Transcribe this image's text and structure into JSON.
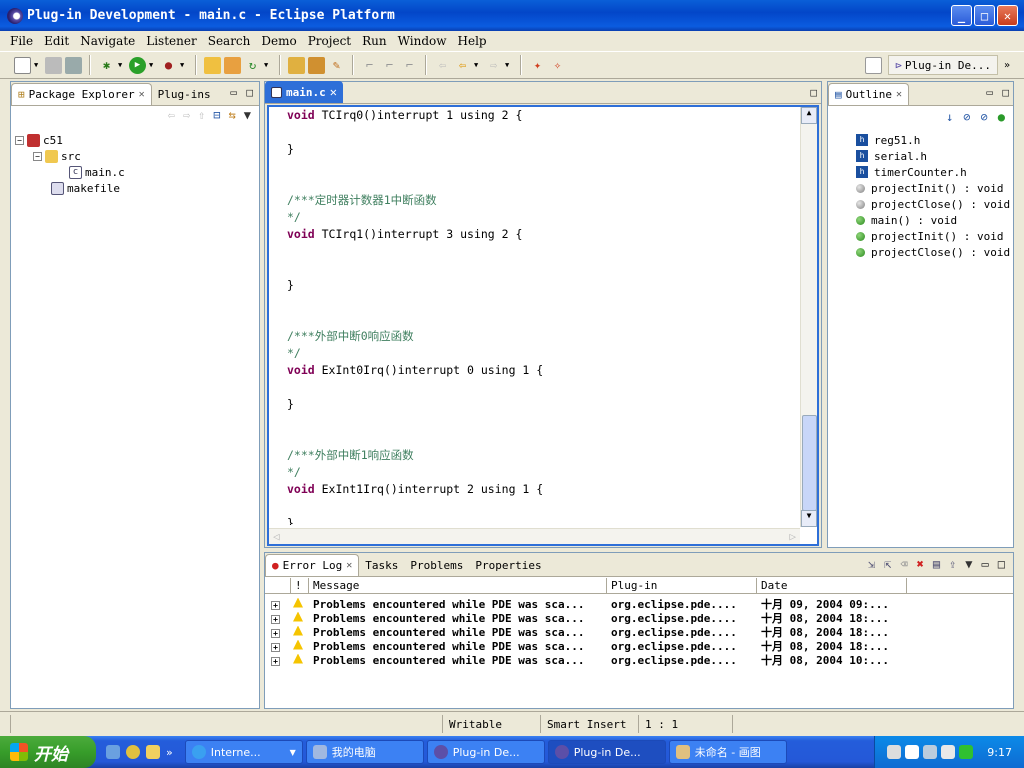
{
  "window": {
    "title": "Plug-in Development - main.c - Eclipse Platform"
  },
  "menu": [
    "File",
    "Edit",
    "Navigate",
    "Listener",
    "Search",
    "Demo",
    "Project",
    "Run",
    "Window",
    "Help"
  ],
  "perspective": {
    "label": "Plug-in De..."
  },
  "package_explorer": {
    "tabs": [
      "Package Explorer",
      "Plug-ins"
    ],
    "tree": [
      {
        "label": "c51",
        "depth": 0,
        "icon": "c-project-icon"
      },
      {
        "label": "src",
        "depth": 1,
        "icon": "folder-icon"
      },
      {
        "label": "main.c",
        "depth": 2,
        "icon": "c-file-icon"
      },
      {
        "label": "makefile",
        "depth": 1,
        "icon": "makefile-icon"
      }
    ]
  },
  "editor": {
    "tab": "main.c",
    "lines": [
      {
        "kw": "void",
        "rest": " TCIrq0()interrupt 1 using 2 {"
      },
      {
        "text": ""
      },
      {
        "text": "}"
      },
      {
        "text": ""
      },
      {
        "text": ""
      },
      {
        "comment": "/***定时器计数器1中断函数"
      },
      {
        "comment": "*/"
      },
      {
        "kw": "void",
        "rest": " TCIrq1()interrupt 3 using 2 {"
      },
      {
        "text": ""
      },
      {
        "text": ""
      },
      {
        "text": "}"
      },
      {
        "text": ""
      },
      {
        "text": ""
      },
      {
        "comment": "/***外部中断0响应函数"
      },
      {
        "comment": "*/"
      },
      {
        "kw": "void",
        "rest": " ExInt0Irq()interrupt 0 using 1 {"
      },
      {
        "text": ""
      },
      {
        "text": "}"
      },
      {
        "text": ""
      },
      {
        "text": ""
      },
      {
        "comment": "/***外部中断1响应函数"
      },
      {
        "comment": "*/"
      },
      {
        "kw": "void",
        "rest": " ExInt1Irq()interrupt 2 using 1 {"
      },
      {
        "text": ""
      },
      {
        "text": "}"
      }
    ]
  },
  "outline": {
    "tab": "Outline",
    "items": [
      {
        "label": "reg51.h",
        "icon": "include"
      },
      {
        "label": "serial.h",
        "icon": "include"
      },
      {
        "label": "timerCounter.h",
        "icon": "include"
      },
      {
        "label": "projectInit() : void",
        "icon": "grey"
      },
      {
        "label": "projectClose() : void",
        "icon": "grey"
      },
      {
        "label": "main() : void",
        "icon": "green"
      },
      {
        "label": "projectInit() : void",
        "icon": "green"
      },
      {
        "label": "projectClose() : void",
        "icon": "green"
      }
    ]
  },
  "bottom_panel": {
    "tabs": [
      "Error Log",
      "Tasks",
      "Problems",
      "Properties"
    ],
    "columns": [
      "!",
      "Message",
      "Plug-in",
      "Date"
    ],
    "rows": [
      {
        "message": "Problems encountered while PDE was sca...",
        "plugin": "org.eclipse.pde....",
        "date": "十月 09, 2004 09:..."
      },
      {
        "message": "Problems encountered while PDE was sca...",
        "plugin": "org.eclipse.pde....",
        "date": "十月 08, 2004 18:..."
      },
      {
        "message": "Problems encountered while PDE was sca...",
        "plugin": "org.eclipse.pde....",
        "date": "十月 08, 2004 18:..."
      },
      {
        "message": "Problems encountered while PDE was sca...",
        "plugin": "org.eclipse.pde....",
        "date": "十月 08, 2004 18:..."
      },
      {
        "message": "Problems encountered while PDE was sca...",
        "plugin": "org.eclipse.pde....",
        "date": "十月 08, 2004 10:..."
      }
    ]
  },
  "status": {
    "writable": "Writable",
    "insert_mode": "Smart Insert",
    "position": "1 : 1"
  },
  "taskbar": {
    "start": "开始",
    "tasks": [
      "Interne...",
      "我的电脑",
      "Plug-in De...",
      "Plug-in De...",
      "未命名 - 画图"
    ],
    "clock": "9:17"
  }
}
